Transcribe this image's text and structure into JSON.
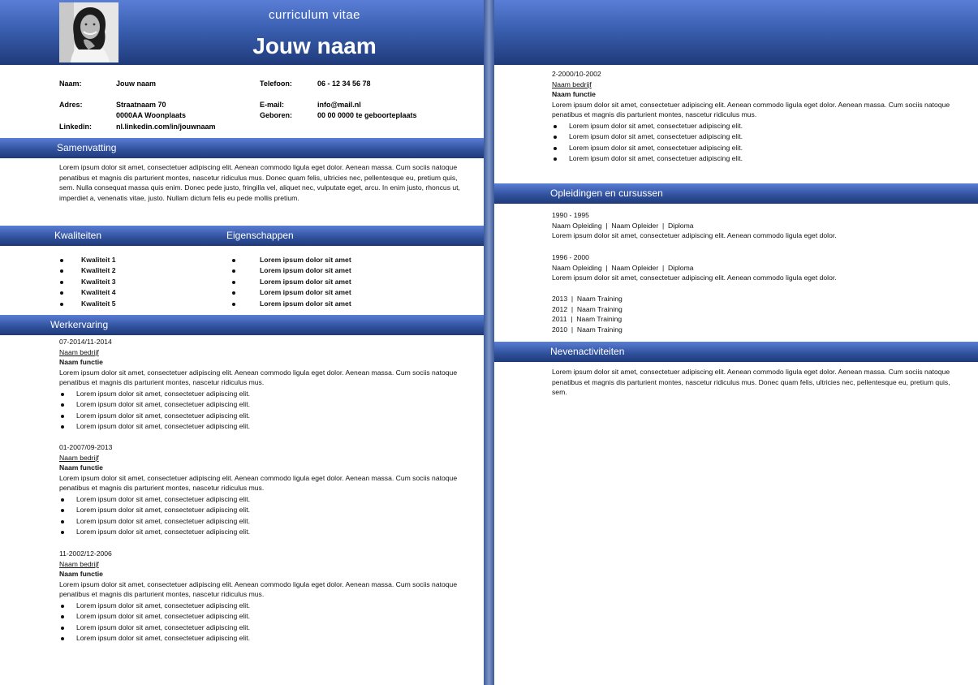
{
  "header": {
    "cv_label": "curriculum vitae",
    "name": "Jouw naam"
  },
  "personal": {
    "naam_label": "Naam:",
    "naam_value": "Jouw naam",
    "adres_label": "Adres:",
    "adres_line1": "Straatnaam 70",
    "adres_line2": "0000AA Woonplaats",
    "linkedin_label": "Linkedin:",
    "linkedin_value": "nl.linkedin.com/in/jouwnaam",
    "telefoon_label": "Telefoon:",
    "telefoon_value": "06 - 12 34 56 78",
    "email_label": "E-mail:",
    "email_value": "info@mail.nl",
    "geboren_label": "Geboren:",
    "geboren_value": "00 00 0000 te geboorteplaats"
  },
  "sections": {
    "samenvatting": "Samenvatting",
    "kwaliteiten": "Kwaliteiten",
    "eigenschappen": "Eigenschappen",
    "werkervaring": "Werkervaring",
    "opleidingen": "Opleidingen en cursussen",
    "nevenactiviteiten": "Nevenactiviteiten"
  },
  "summary": "Lorem ipsum dolor sit amet, consectetuer adipiscing elit. Aenean commodo ligula eget dolor. Aenean massa. Cum sociis natoque penatibus et magnis dis parturient montes, nascetur ridiculus mus. Donec quam felis, ultricies nec, pellentesque eu, pretium quis, sem. Nulla consequat massa quis enim. Donec pede justo, fringilla vel, aliquet nec, vulputate eget, arcu. In enim justo, rhoncus ut, imperdiet a, venenatis vitae, justo. Nullam dictum felis eu pede mollis pretium.",
  "qualities": [
    "Kwaliteit 1",
    "Kwaliteit 2",
    "Kwaliteit 3",
    "Kwaliteit 4",
    "Kwaliteit 5"
  ],
  "traits": [
    "Lorem ipsum dolor sit amet",
    "Lorem ipsum dolor sit amet",
    "Lorem ipsum dolor sit amet",
    "Lorem ipsum dolor sit amet",
    "Lorem ipsum dolor sit amet"
  ],
  "jobs": [
    {
      "date": "07-2014/11-2014",
      "company": "Naam bedrijf",
      "role": "Naam functie",
      "desc": "Lorem ipsum dolor sit amet, consectetuer adipiscing elit. Aenean commodo ligula eget dolor. Aenean massa. Cum sociis natoque penatibus et magnis dis parturient montes, nascetur ridiculus mus.",
      "bullets": [
        "Lorem ipsum dolor sit amet, consectetuer adipiscing elit.",
        "Lorem ipsum dolor sit amet, consectetuer adipiscing elit.",
        "Lorem ipsum dolor sit amet, consectetuer adipiscing elit.",
        "Lorem ipsum dolor sit amet, consectetuer adipiscing elit."
      ]
    },
    {
      "date": "01-2007/09-2013",
      "company": "Naam bedrijf",
      "role": "Naam functie",
      "desc": "Lorem ipsum dolor sit amet, consectetuer adipiscing elit. Aenean commodo ligula eget dolor. Aenean massa. Cum sociis natoque penatibus et magnis dis parturient montes, nascetur ridiculus mus.",
      "bullets": [
        "Lorem ipsum dolor sit amet, consectetuer adipiscing elit.",
        "Lorem ipsum dolor sit amet, consectetuer adipiscing elit.",
        "Lorem ipsum dolor sit amet, consectetuer adipiscing elit.",
        "Lorem ipsum dolor sit amet, consectetuer adipiscing elit."
      ]
    },
    {
      "date": "11-2002/12-2006",
      "company": "Naam bedrijf",
      "role": "Naam functie",
      "desc": "Lorem ipsum dolor sit amet, consectetuer adipiscing elit. Aenean commodo ligula eget dolor. Aenean massa. Cum sociis natoque penatibus et magnis dis parturient montes, nascetur ridiculus mus.",
      "bullets": [
        "Lorem ipsum dolor sit amet, consectetuer adipiscing elit.",
        "Lorem ipsum dolor sit amet, consectetuer adipiscing elit.",
        "Lorem ipsum dolor sit amet, consectetuer adipiscing elit.",
        "Lorem ipsum dolor sit amet, consectetuer adipiscing elit."
      ]
    },
    {
      "date": "2-2000/10-2002",
      "company": "Naam bedrijf",
      "role": "Naam functie",
      "desc": "Lorem ipsum dolor sit amet, consectetuer adipiscing elit. Aenean commodo ligula eget dolor. Aenean massa. Cum sociis natoque penatibus et magnis dis parturient montes, nascetur ridiculus mus.",
      "bullets": [
        "Lorem ipsum dolor sit amet, consectetuer adipiscing elit.",
        "Lorem ipsum dolor sit amet, consectetuer adipiscing elit.",
        "Lorem ipsum dolor sit amet, consectetuer adipiscing elit.",
        "Lorem ipsum dolor sit amet, consectetuer adipiscing elit."
      ]
    }
  ],
  "education": [
    {
      "years": "1990 - 1995",
      "detail": "Naam Opleiding  |  Naam Opleider  |  Diploma",
      "desc": "Lorem ipsum dolor sit amet, consectetuer adipiscing elit. Aenean commodo ligula eget dolor."
    },
    {
      "years": "1996 - 2000",
      "detail": "Naam Opleiding  |  Naam Opleider  |  Diploma",
      "desc": "Lorem ipsum dolor sit amet, consectetuer adipiscing elit. Aenean commodo ligula eget dolor."
    }
  ],
  "trainings": [
    "2013  |  Naam Training",
    "2012  |  Naam Training",
    "2011  |  Naam Training",
    "2010  |  Naam Training"
  ],
  "side_activities": "Lorem ipsum dolor sit amet, consectetuer adipiscing elit. Aenean commodo ligula eget dolor. Aenean massa. Cum sociis natoque penatibus et magnis dis parturient montes, nascetur ridiculus mus. Donec quam felis, ultricies nec, pellentesque eu, pretium quis, sem."
}
